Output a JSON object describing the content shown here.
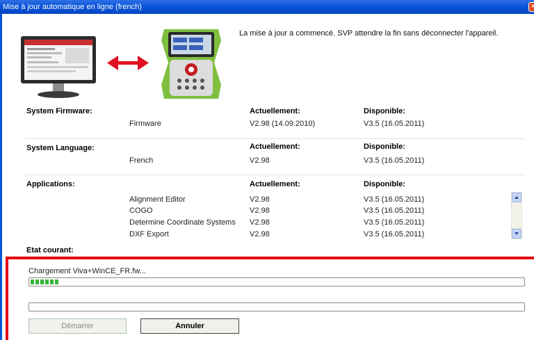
{
  "window": {
    "title": "Mise à jour automatique en ligne (french)",
    "close_glyph": "×"
  },
  "message": "La mise à jour a commencé. SVP attendre la fin sans déconnecter l'appareil.",
  "columns": {
    "current": "Actuellement:",
    "available": "Disponible:"
  },
  "firmware": {
    "header": "System Firmware:",
    "name": "Firmware",
    "current": "V2.98 (14.09.2010)",
    "available": "V3.5 (16.05.2011)"
  },
  "language": {
    "header": "System Language:",
    "name": "French",
    "current": "V2.98",
    "available": "V3.5 (16.05.2011)"
  },
  "applications": {
    "header": "Applications:",
    "rows": [
      {
        "name": "Alignment Editor",
        "current": "V2.98",
        "available": "V3.5 (16.05.2011)"
      },
      {
        "name": "COGO",
        "current": "V2.98",
        "available": "V3.5 (16.05.2011)"
      },
      {
        "name": "Determine Coordinate Systems",
        "current": "V2.98",
        "available": "V3.5 (16.05.2011)"
      },
      {
        "name": "DXF Export",
        "current": "V2.98",
        "available": "V3.5 (16.05.2011)"
      }
    ]
  },
  "status": {
    "header": "Etat courant:",
    "loading_text": "Chargement  Viva+WinCE_FR.fw...",
    "progress_fraction": 0.06,
    "overall_progress_fraction": 0
  },
  "buttons": {
    "start": "Démarrer",
    "cancel": "Annuler"
  },
  "colors": {
    "title_bar": "#0a54d8",
    "highlight_box": "#e2000f",
    "progress": "#35b535",
    "arrow": "#e01020"
  }
}
